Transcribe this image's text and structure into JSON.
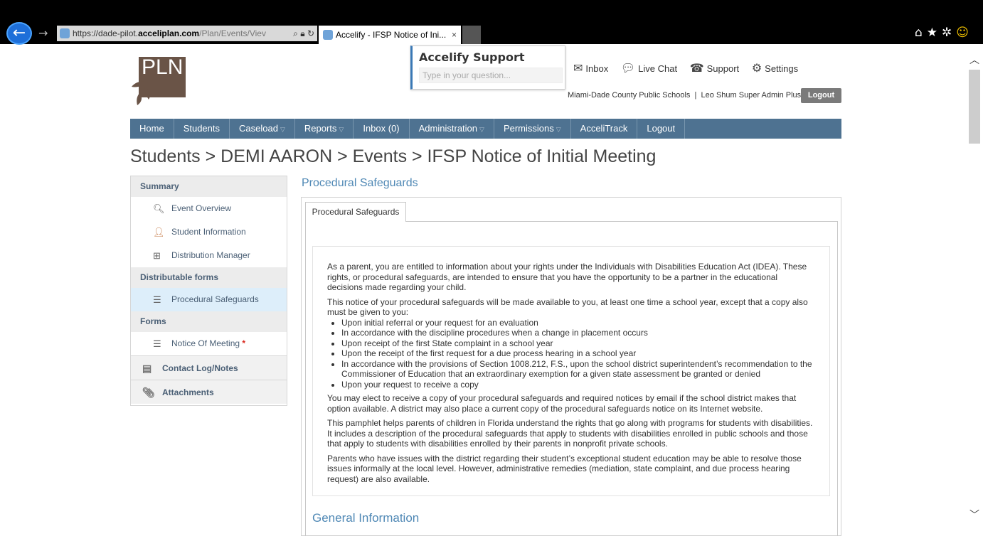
{
  "browser": {
    "url_prefix": "https://dade-pilot.",
    "url_domain": "acceliplan.com",
    "url_path": "/Plan/Events/Viev",
    "tab_title": "Accelify - IFSP Notice of Ini...",
    "tab_close": "×"
  },
  "logo": {
    "text": "PLN"
  },
  "support": {
    "title": "Accelify Support",
    "placeholder": "Type in your question..."
  },
  "toplinks": {
    "inbox": "Inbox",
    "live_chat": "Live Chat",
    "support": "Support",
    "settings": "Settings"
  },
  "user_line": {
    "org": "Miami-Dade County Public Schools",
    "sep": "|",
    "user": "Leo Shum Super Admin Plus"
  },
  "logout_top": "Logout",
  "nav": {
    "items": [
      {
        "label": "Home",
        "caret": ""
      },
      {
        "label": "Students",
        "caret": ""
      },
      {
        "label": "Caseload",
        "caret": "▽"
      },
      {
        "label": "Reports",
        "caret": "▽"
      },
      {
        "label": "Inbox (0)",
        "caret": ""
      },
      {
        "label": "Administration",
        "caret": "▽"
      },
      {
        "label": "Permissions",
        "caret": "▽"
      },
      {
        "label": "AcceliTrack",
        "caret": ""
      },
      {
        "label": "Logout",
        "caret": ""
      }
    ]
  },
  "breadcrumb": "Students > DEMI AARON > Events > IFSP Notice of Initial Meeting",
  "sidebar": {
    "summary": "Summary",
    "event_overview": "Event Overview",
    "student_information": "Student Information",
    "distribution_manager": "Distribution Manager",
    "distributable_forms": "Distributable forms",
    "procedural_safeguards": "Procedural Safeguards",
    "forms": "Forms",
    "notice_of_meeting": "Notice Of Meeting",
    "required_mark": "*",
    "contact_log": "Contact Log/Notes",
    "attachments": "Attachments"
  },
  "content": {
    "title": "Procedural Safeguards",
    "tab": "Procedural Safeguards",
    "p1": "As a parent, you are entitled to information about your rights under the Individuals with Disabilities Education Act (IDEA). These rights, or procedural safeguards, are intended to ensure that you have the opportunity to be a partner in the educational decisions made regarding your child.",
    "p2": "This notice of your procedural safeguards will be made available to you, at least one time a school year, except that a copy also must be given to you:",
    "bullets": [
      "Upon initial referral or your request for an evaluation",
      "In accordance with the discipline procedures when a change in placement occurs",
      "Upon receipt of the first State complaint in a school year",
      "Upon the receipt of the first request for a due process hearing in a school year",
      "In accordance with the provisions of Section 1008.212, F.S., upon the school district superintendent’s recommendation to the Commissioner of Education that an extraordinary exemption for a given state assessment be granted or denied",
      "Upon your request to receive a copy"
    ],
    "p3": "You may elect to receive a copy of your procedural safeguards and required notices by email if the school district makes that option available. A district may also place a current copy of the procedural safeguards notice on its Internet website.",
    "p4": "This pamphlet helps parents of children in Florida understand the rights that go along with programs for students with disabilities. It includes a description of the procedural safeguards that apply to students with disabilities enrolled in public schools and those that apply to students with disabilities enrolled by their parents in nonprofit private schools.",
    "p5": "Parents who have issues with the district regarding their student’s exceptional student education may be able to resolve those issues informally at the local level. However, administrative remedies (mediation, state complaint, and due process hearing request) are also available.",
    "general_info": "General Information"
  },
  "colors": {
    "nav_bg": "#4e7291",
    "link_blue": "#4f88b5",
    "active_item_bg": "#ddeefa",
    "logo_brown": "#6a5447"
  }
}
